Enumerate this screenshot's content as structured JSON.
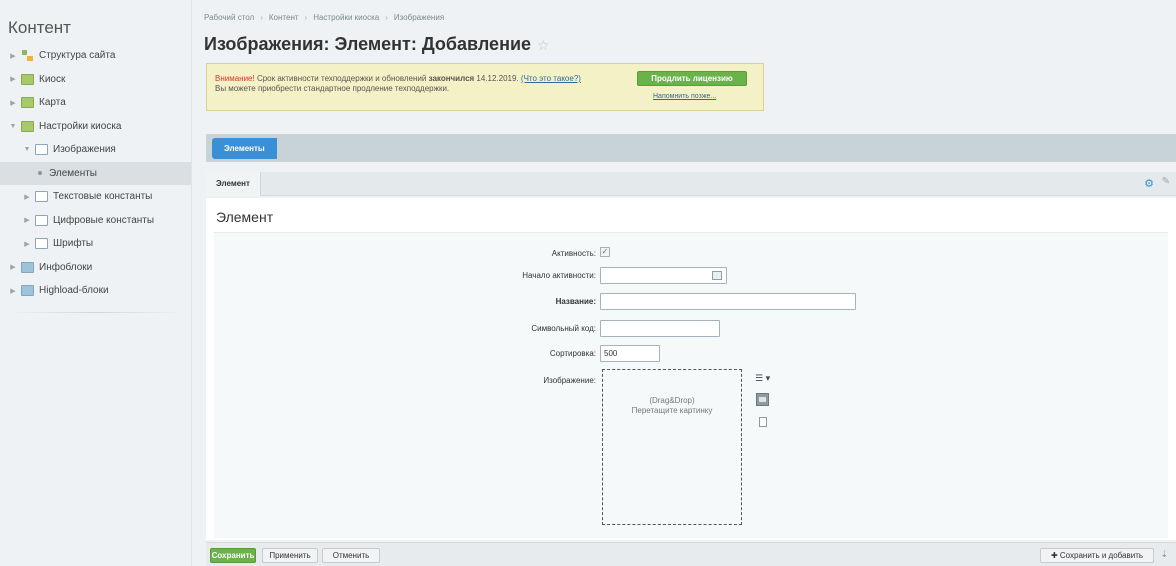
{
  "sidebar": {
    "title": "Контент",
    "items": [
      {
        "label": "Структура сайта"
      },
      {
        "label": "Киоск"
      },
      {
        "label": "Карта"
      },
      {
        "label": "Настройки киоска"
      },
      {
        "label": "Изображения"
      },
      {
        "label": "Элементы"
      },
      {
        "label": "Текстовые константы"
      },
      {
        "label": "Цифровые константы"
      },
      {
        "label": "Шрифты"
      },
      {
        "label": "Инфоблоки"
      },
      {
        "label": "Highload-блоки"
      }
    ]
  },
  "breadcrumb": [
    "Рабочий стол",
    "Контент",
    "Настройки киоска",
    "Изображения"
  ],
  "page_title": "Изображения: Элемент: Добавление",
  "notice": {
    "warning_word": "Внимание!",
    "text_before": " Срок активности техподдержки и обновлений ",
    "bold_text": "закончился",
    "date": " 14.12.2019. ",
    "link": "(Что это такое?)",
    "line2": "Вы можете приобрести стандартное продление техподдержки.",
    "license_button": "Продлить лицензию",
    "remind_link": "Напомнить позже..."
  },
  "tabbar": {
    "elements_tab": "Элементы"
  },
  "panel": {
    "tab_label": "Элемент"
  },
  "form": {
    "heading": "Элемент",
    "activity_label": "Активность:",
    "activity_checked": true,
    "start_label": "Начало активности:",
    "start_value": "",
    "name_label": "Название:",
    "name_value": "",
    "code_label": "Символьный код:",
    "code_value": "",
    "sort_label": "Сортировка:",
    "sort_value": "500",
    "image_label": "Изображение:",
    "dropzone_line1": "(Drag&Drop)",
    "dropzone_line2": "Перетащите картинку"
  },
  "bottom": {
    "save": "Сохранить",
    "apply": "Применить",
    "cancel": "Отменить",
    "save_add": "Сохранить и добавить"
  },
  "colors": {
    "accent": "#3a8fd6",
    "green": "#6ab24a",
    "warning": "#dd3333"
  }
}
